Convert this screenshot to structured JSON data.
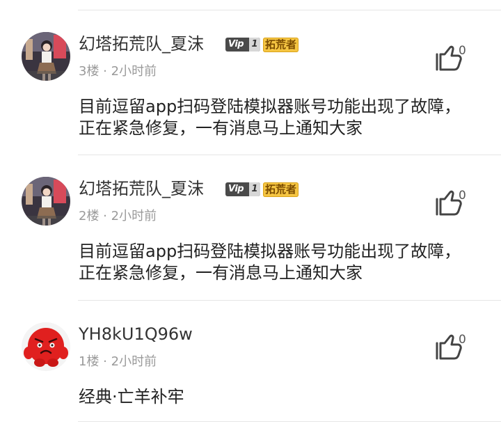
{
  "comments": [
    {
      "username": "幻塔拓荒队_夏沫",
      "vip_label": "Vip",
      "vip_level": "1",
      "title_badge": "拓荒者",
      "meta": "3楼 · 2小时前",
      "content": "目前逗留app扫码登陆模拟器账号功能出现了故障，正在紧急修复，一有消息马上通知大家",
      "like_count": "0",
      "avatar": "girl-photo-avatar",
      "like_icon": "thumbs-up-icon"
    },
    {
      "username": "幻塔拓荒队_夏沫",
      "vip_label": "Vip",
      "vip_level": "1",
      "title_badge": "拓荒者",
      "meta": "2楼 · 2小时前",
      "content": "目前逗留app扫码登陆模拟器账号功能出现了故障，正在紧急修复，一有消息马上通知大家",
      "like_count": "0",
      "avatar": "girl-photo-avatar",
      "like_icon": "thumbs-up-icon"
    },
    {
      "username": "YH8kU1Q96w",
      "meta": "1楼 · 2小时前",
      "content": "经典·亡羊补牢",
      "like_count": "0",
      "avatar": "red-cartoon-avatar",
      "like_icon": "thumbs-up-icon"
    }
  ],
  "colors": {
    "text_primary": "#222222",
    "text_secondary": "#9a9a9a",
    "divider": "#e6e6e6",
    "vip_badge": "#4a4a4a",
    "pioneer_badge": "#f5c542"
  }
}
